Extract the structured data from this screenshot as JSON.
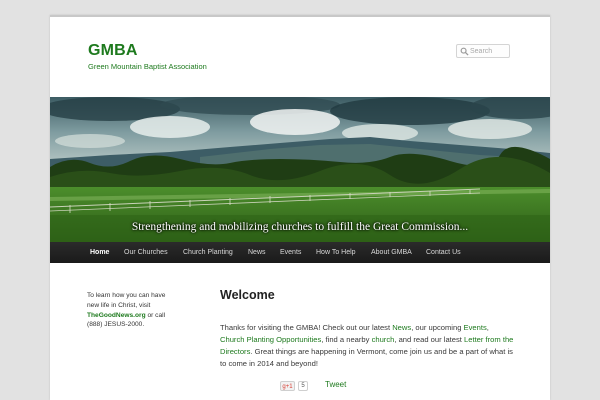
{
  "site": {
    "title": "GMBA",
    "description": "Green Mountain Baptist Association"
  },
  "search": {
    "placeholder": "Search"
  },
  "banner": {
    "tagline": "Strengthening and mobilizing churches to fulfill the Great Commission..."
  },
  "nav": {
    "items": [
      "Home",
      "Our Churches",
      "Church Planting",
      "News",
      "Events",
      "How To Help",
      "About GMBA",
      "Contact Us"
    ],
    "active": "Home"
  },
  "sidebar": {
    "line1": "To learn how you can have",
    "line2": "new life in Christ, visit",
    "link": "TheGoodNews.org",
    "line3_suffix": " or call",
    "line4": "(888) JESUS-2000."
  },
  "main": {
    "heading": "Welcome",
    "p_intro": "Thanks for visiting the GMBA! Check out our latest ",
    "link_news": "News",
    "p_2": ", our upcoming ",
    "link_events": "Events",
    "p_3": ", ",
    "link_planting": "Church Planting Opportunities",
    "p_4": ", find a nearby ",
    "link_church": "church",
    "p_5": ", and read our latest ",
    "link_letter": "Letter from the Directors",
    "p_6": ". Great things are happening in Vermont, come join us and be a part of what is to come in 2014 and beyond!"
  },
  "share": {
    "gplus_label": "g+1",
    "gplus_count": "5",
    "tweet_label": "Tweet"
  },
  "colors": {
    "brand_green": "#1e7a1e",
    "nav_bg": "#222222",
    "page_bg": "#e2e2e2"
  }
}
